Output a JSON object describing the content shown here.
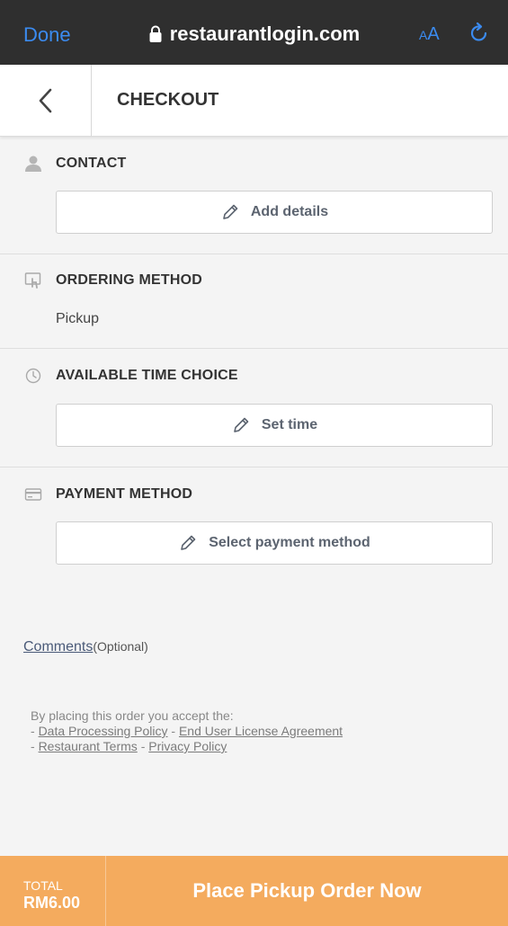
{
  "browser": {
    "done_label": "Done",
    "url": "restaurantlogin.com",
    "text_size_small": "A",
    "text_size_large": "A",
    "lock_icon": "lock-icon",
    "reload_icon": "reload-icon"
  },
  "header": {
    "title": "CHECKOUT",
    "back_icon": "chevron-left-icon"
  },
  "contact": {
    "title": "CONTACT",
    "icon": "person-icon",
    "button_label": "Add details"
  },
  "ordering_method": {
    "title": "ORDERING METHOD",
    "icon": "touch-screen-icon",
    "value": "Pickup"
  },
  "time_choice": {
    "title": "AVAILABLE TIME CHOICE",
    "icon": "clock-icon",
    "button_label": "Set time"
  },
  "payment": {
    "title": "PAYMENT METHOD",
    "icon": "credit-card-icon",
    "button_label": "Select payment method"
  },
  "comments": {
    "link_label": "Comments",
    "optional_label": "(Optional)"
  },
  "legal": {
    "intro": "By placing this order you accept the:",
    "dash": "-",
    "sep": "-",
    "data_processing": "Data Processing Policy",
    "eula": "End User License Agreement",
    "restaurant_terms": "Restaurant Terms",
    "privacy": "Privacy Policy"
  },
  "footer": {
    "total_label": "TOTAL",
    "total_value": "RM6.00",
    "cta_label": "Place Pickup Order Now"
  },
  "colors": {
    "browser_bg": "#2f2f2f",
    "browser_accent": "#3b8bf0",
    "cta_bg": "#f4ab5e",
    "page_bg": "#f4f4f4"
  }
}
